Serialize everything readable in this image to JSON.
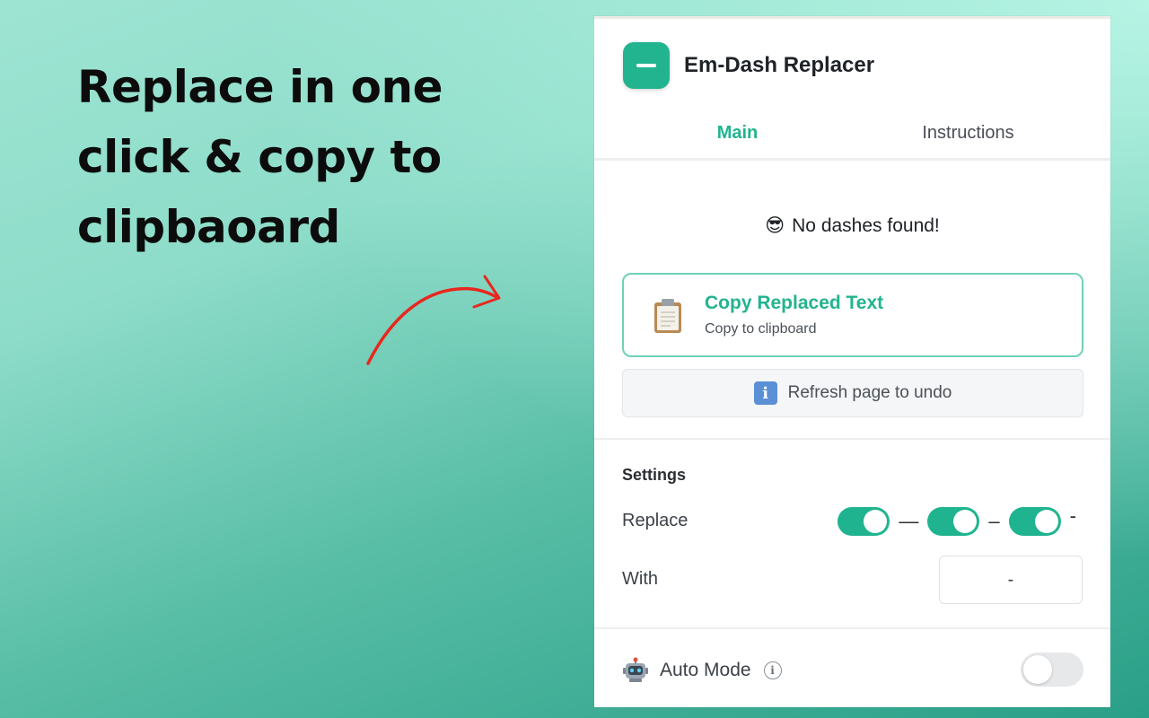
{
  "promo": {
    "line1": "Replace in one",
    "line2": "click & copy to",
    "line3": "clipbaoard"
  },
  "popup": {
    "title": "Em-Dash Replacer",
    "tabs": [
      {
        "label": "Main",
        "active": true
      },
      {
        "label": "Instructions",
        "active": false
      }
    ],
    "status": {
      "emoji": "😎",
      "text": "No dashes found!"
    },
    "copy_button": {
      "label": "Copy Replaced Text",
      "sub": "Copy to clipboard"
    },
    "undo_button": {
      "label": "Refresh page to undo"
    },
    "settings": {
      "title": "Settings",
      "replace_label": "Replace",
      "dashes": [
        {
          "glyph": "—",
          "enabled": true
        },
        {
          "glyph": "–",
          "enabled": true
        },
        {
          "glyph": "-",
          "enabled": true
        }
      ],
      "with_label": "With",
      "with_value": "-"
    },
    "auto_mode": {
      "label": "Auto Mode",
      "enabled": false
    }
  },
  "colors": {
    "accent": "#1fb48f",
    "arrow": "#e8271e"
  }
}
